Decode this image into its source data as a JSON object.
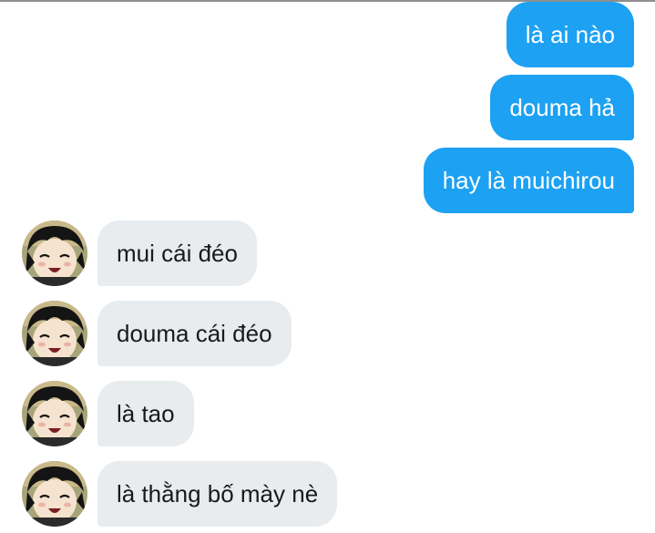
{
  "conversation": {
    "messages": [
      {
        "side": "sent",
        "text": "là ai nào"
      },
      {
        "side": "sent",
        "text": "douma hả"
      },
      {
        "side": "sent",
        "text": "hay là muichirou"
      },
      {
        "side": "received",
        "text": "mui cái đéo"
      },
      {
        "side": "received",
        "text": "douma cái đéo"
      },
      {
        "side": "received",
        "text": "là tao"
      },
      {
        "side": "received",
        "text": "là thằng bố mày nè"
      }
    ]
  },
  "colors": {
    "sent_bubble": "#1da1f2",
    "received_bubble": "#e8ecef",
    "sent_text": "#ffffff",
    "received_text": "#1a1a1a"
  },
  "icons": {
    "avatar": "anime-character-avatar"
  }
}
